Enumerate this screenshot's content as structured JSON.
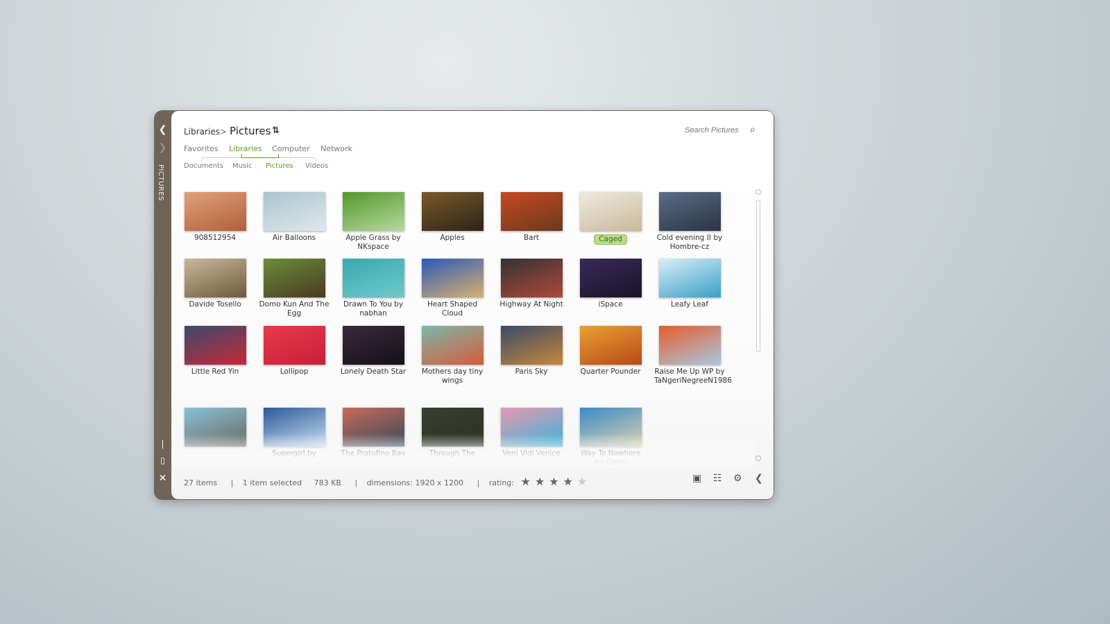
{
  "sidebar": {
    "vertical_label": "PICTURES",
    "back_icon": "chevron-left",
    "forward_icon": "chevron-right",
    "minimize_icon": "minimize",
    "maximize_icon": "maximize",
    "close_icon": "close"
  },
  "breadcrumb": {
    "root": "Libraries",
    "sep": ">",
    "current": "Pictures",
    "refresh_icon": "swap-arrows"
  },
  "nav": {
    "top": [
      "Favorites",
      "Libraries",
      "Computer",
      "Network"
    ],
    "top_active": 1,
    "sub": [
      "Documents",
      "Music",
      "Pictures",
      "Videos"
    ],
    "sub_active": 2
  },
  "search": {
    "placeholder": "Search Pictures",
    "icon": "search"
  },
  "accent": "#5a9e1e",
  "items": [
    {
      "label": "908512954",
      "c": [
        "#e0a07a",
        "#b0603a"
      ]
    },
    {
      "label": "Air Balloons",
      "c": [
        "#a9c4cf",
        "#dfe8ea"
      ]
    },
    {
      "label": "Apple Grass by NKspace",
      "c": [
        "#4f9a2a",
        "#b9d6a0"
      ]
    },
    {
      "label": "Apples",
      "c": [
        "#7a5a2a",
        "#2d2418"
      ]
    },
    {
      "label": "Bart",
      "c": [
        "#c74a22",
        "#6b3a1e"
      ]
    },
    {
      "label": "Caged",
      "c": [
        "#eeeae0",
        "#c9b89a"
      ],
      "selected": true
    },
    {
      "label": "Cold evening II by Hombre-cz",
      "c": [
        "#5a6e88",
        "#2a3444"
      ]
    },
    {
      "label": "Davide Tosello",
      "c": [
        "#c8b89a",
        "#6e5a3a"
      ]
    },
    {
      "label": "Domo Kun And The Egg",
      "c": [
        "#6a8e3a",
        "#4a3a22"
      ]
    },
    {
      "label": "Drawn To You by nabhan",
      "c": [
        "#3aa8b0",
        "#6ecac8"
      ]
    },
    {
      "label": "Heart Shaped Cloud",
      "c": [
        "#2a5ab8",
        "#d8b070"
      ]
    },
    {
      "label": "Highway At Night",
      "c": [
        "#333",
        "#b04a3a"
      ]
    },
    {
      "label": "iSpace",
      "c": [
        "#3a2a5a",
        "#181428"
      ]
    },
    {
      "label": "Leafy Leaf",
      "c": [
        "#d8eef5",
        "#3a9ec8"
      ]
    },
    {
      "label": "Little Red Yin",
      "c": [
        "#3a4a6a",
        "#c8283a"
      ]
    },
    {
      "label": "Lollipop",
      "c": [
        "#e83a4a",
        "#c8203a"
      ]
    },
    {
      "label": "Lonely Death Star",
      "c": [
        "#3a2a3a",
        "#141018"
      ]
    },
    {
      "label": "Mothers day tiny wings",
      "c": [
        "#7ab8a8",
        "#d85a3a"
      ]
    },
    {
      "label": "Paris Sky",
      "c": [
        "#3a4a6a",
        "#c8883a"
      ]
    },
    {
      "label": "Quarter Pounder",
      "c": [
        "#e8a030",
        "#b84a18"
      ]
    },
    {
      "label": "Raise Me Up WP by TaNgeriNegreeN1986",
      "c": [
        "#e85a2a",
        "#a8c8e0"
      ]
    },
    {
      "label": "",
      "c": [
        "#8ac0d8",
        "#6a6a60"
      ]
    },
    {
      "label": "Supergirl by",
      "c": [
        "#2a5a9a",
        "#c8dcef"
      ]
    },
    {
      "label": "The Protofino Bay",
      "c": [
        "#c86a5a",
        "#3a4a5a"
      ]
    },
    {
      "label": "Through The",
      "c": [
        "#3a4030",
        "#2a3024"
      ]
    },
    {
      "label": "Veni Vidi Venice",
      "c": [
        "#e89ab0",
        "#3ab0d8"
      ]
    },
    {
      "label": "Way To Nowhere by Optiv",
      "c": [
        "#3a8ac8",
        "#d8d0b0"
      ]
    }
  ],
  "status": {
    "count": "27 items",
    "selected": "1 item selected",
    "size": "783 KB",
    "dimensions": "dimensions: 1920 x 1200",
    "rating_label": "rating:",
    "rating": 4,
    "rating_max": 5
  },
  "toolbar": {
    "icons": [
      "preview-pane",
      "details-view",
      "settings",
      "collapse"
    ]
  }
}
